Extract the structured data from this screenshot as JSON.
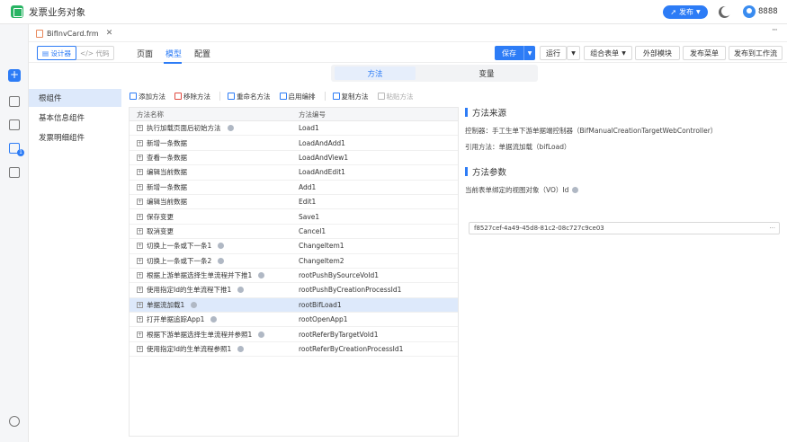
{
  "app": {
    "title": "发票业务对象",
    "publish_label": "发布",
    "user": "8888"
  },
  "file_tab": {
    "name": "BifInvCard.frm"
  },
  "mode_switch": {
    "designer": "设计器",
    "code": "代码"
  },
  "nav_tabs": {
    "page": "页面",
    "model": "模型",
    "config": "配置"
  },
  "toolbar": {
    "save": "保存",
    "run": "运行",
    "combo_form": "组合表单",
    "external_module": "外部模块",
    "publish_menu": "发布菜单",
    "publish_flow": "发布到工作流",
    "more": "···"
  },
  "subtabs": {
    "methods": "方法",
    "variables": "变量"
  },
  "tree": [
    "根组件",
    "基本信息组件",
    "发票明细组件"
  ],
  "actions": {
    "add": "添加方法",
    "remove": "移除方法",
    "rename": "重命名方法",
    "enable_edit": "启用编排",
    "copy": "复制方法",
    "paste": "粘贴方法"
  },
  "grid": {
    "headers": [
      "方法名称",
      "方法编号"
    ],
    "rows": [
      {
        "name": "执行加载页面后初始方法",
        "code": "Load1",
        "info": true
      },
      {
        "name": "新增一条数据",
        "code": "LoadAndAdd1",
        "info": false
      },
      {
        "name": "查看一条数据",
        "code": "LoadAndView1",
        "info": false
      },
      {
        "name": "编辑当前数据",
        "code": "LoadAndEdit1",
        "info": false
      },
      {
        "name": "新增一条数据",
        "code": "Add1",
        "info": false
      },
      {
        "name": "编辑当前数据",
        "code": "Edit1",
        "info": false
      },
      {
        "name": "保存变更",
        "code": "Save1",
        "info": false
      },
      {
        "name": "取消变更",
        "code": "Cancel1",
        "info": false
      },
      {
        "name": "切换上一条或下一条1",
        "code": "ChangeItem1",
        "info": true
      },
      {
        "name": "切换上一条或下一条2",
        "code": "ChangeItem2",
        "info": true
      },
      {
        "name": "根据上游单据选择生单流程并下推1",
        "code": "rootPushBySourceVoId1",
        "info": true
      },
      {
        "name": "使用指定Id的生单流程下推1",
        "code": "rootPushByCreationProcessId1",
        "info": true
      },
      {
        "name": "单据流加载1",
        "code": "rootBifLoad1",
        "info": true
      },
      {
        "name": "打开单据追踪App1",
        "code": "rootOpenApp1",
        "info": true
      },
      {
        "name": "根据下游单据选择生单流程并参照1",
        "code": "rootReferByTargetVoId1",
        "info": true
      },
      {
        "name": "使用指定Id的生单流程参照1",
        "code": "rootReferByCreationProcessId1",
        "info": true
      }
    ],
    "selected_index": 12
  },
  "method_source": {
    "title": "方法来源",
    "controller": "控制器：手工生单下游单据端控制器（BifManualCreationTargetWebController）",
    "ref_method": "引用方法：单据流加载（bifLoad）"
  },
  "method_params": {
    "title": "方法参数",
    "param_label": "当前表单绑定的视图对象（VO）Id",
    "param_value": "f8527cef-4a49-45d8-81c2-08c727c9ce03"
  },
  "colors": {
    "accent": "#2d7cf6",
    "selected_row": "#dde9fb"
  }
}
